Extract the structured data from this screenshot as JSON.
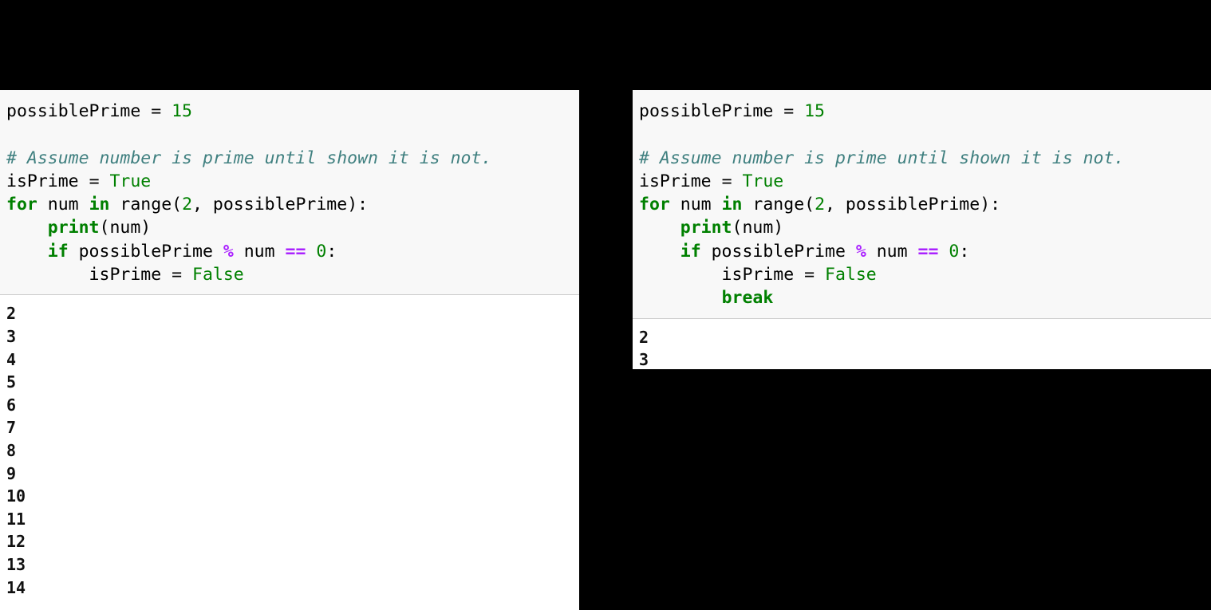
{
  "colors": {
    "background": "#000000",
    "panel_bg": "#ffffff",
    "code_bg": "#f8f8f8",
    "keyword": "#008000",
    "number": "#008000",
    "boolean": "#008000",
    "operator": "#aa22ff",
    "comment": "#408080",
    "plain_text": "#000000",
    "separator": "#cfcfcf"
  },
  "panels": [
    {
      "id": "left",
      "name": "without-break-example",
      "code_lines": [
        [
          {
            "text": "possiblePrime ",
            "type": "plain"
          },
          {
            "text": "= ",
            "type": "plain"
          },
          {
            "text": "15",
            "type": "num"
          }
        ],
        [
          {
            "text": "",
            "type": "plain"
          }
        ],
        [
          {
            "text": "# Assume number is prime until shown it is not.",
            "type": "comment"
          }
        ],
        [
          {
            "text": "isPrime ",
            "type": "plain"
          },
          {
            "text": "= ",
            "type": "plain"
          },
          {
            "text": "True",
            "type": "bool"
          }
        ],
        [
          {
            "text": "for",
            "type": "kw"
          },
          {
            "text": " num ",
            "type": "plain"
          },
          {
            "text": "in",
            "type": "kw"
          },
          {
            "text": " range(",
            "type": "plain"
          },
          {
            "text": "2",
            "type": "num"
          },
          {
            "text": ", possiblePrime):",
            "type": "plain"
          }
        ],
        [
          {
            "text": "    ",
            "type": "plain"
          },
          {
            "text": "print",
            "type": "fn"
          },
          {
            "text": "(num)",
            "type": "plain"
          }
        ],
        [
          {
            "text": "    ",
            "type": "plain"
          },
          {
            "text": "if",
            "type": "kw"
          },
          {
            "text": " possiblePrime ",
            "type": "plain"
          },
          {
            "text": "%",
            "type": "op"
          },
          {
            "text": " num ",
            "type": "plain"
          },
          {
            "text": "==",
            "type": "op"
          },
          {
            "text": " ",
            "type": "plain"
          },
          {
            "text": "0",
            "type": "num"
          },
          {
            "text": ":",
            "type": "plain"
          }
        ],
        [
          {
            "text": "        isPrime ",
            "type": "plain"
          },
          {
            "text": "= ",
            "type": "plain"
          },
          {
            "text": "False",
            "type": "bool"
          }
        ]
      ],
      "output_lines": [
        "2",
        "3",
        "4",
        "5",
        "6",
        "7",
        "8",
        "9",
        "10",
        "11",
        "12",
        "13",
        "14"
      ]
    },
    {
      "id": "right",
      "name": "with-break-example",
      "code_lines": [
        [
          {
            "text": "possiblePrime ",
            "type": "plain"
          },
          {
            "text": "= ",
            "type": "plain"
          },
          {
            "text": "15",
            "type": "num"
          }
        ],
        [
          {
            "text": "",
            "type": "plain"
          }
        ],
        [
          {
            "text": "# Assume number is prime until shown it is not.",
            "type": "comment"
          }
        ],
        [
          {
            "text": "isPrime ",
            "type": "plain"
          },
          {
            "text": "= ",
            "type": "plain"
          },
          {
            "text": "True",
            "type": "bool"
          }
        ],
        [
          {
            "text": "for",
            "type": "kw"
          },
          {
            "text": " num ",
            "type": "plain"
          },
          {
            "text": "in",
            "type": "kw"
          },
          {
            "text": " range(",
            "type": "plain"
          },
          {
            "text": "2",
            "type": "num"
          },
          {
            "text": ", possiblePrime):",
            "type": "plain"
          }
        ],
        [
          {
            "text": "    ",
            "type": "plain"
          },
          {
            "text": "print",
            "type": "fn"
          },
          {
            "text": "(num)",
            "type": "plain"
          }
        ],
        [
          {
            "text": "    ",
            "type": "plain"
          },
          {
            "text": "if",
            "type": "kw"
          },
          {
            "text": " possiblePrime ",
            "type": "plain"
          },
          {
            "text": "%",
            "type": "op"
          },
          {
            "text": " num ",
            "type": "plain"
          },
          {
            "text": "==",
            "type": "op"
          },
          {
            "text": " ",
            "type": "plain"
          },
          {
            "text": "0",
            "type": "num"
          },
          {
            "text": ":",
            "type": "plain"
          }
        ],
        [
          {
            "text": "        isPrime ",
            "type": "plain"
          },
          {
            "text": "= ",
            "type": "plain"
          },
          {
            "text": "False",
            "type": "bool"
          }
        ],
        [
          {
            "text": "        ",
            "type": "plain"
          },
          {
            "text": "break",
            "type": "kw"
          }
        ]
      ],
      "output_lines": [
        "2",
        "3"
      ]
    }
  ]
}
